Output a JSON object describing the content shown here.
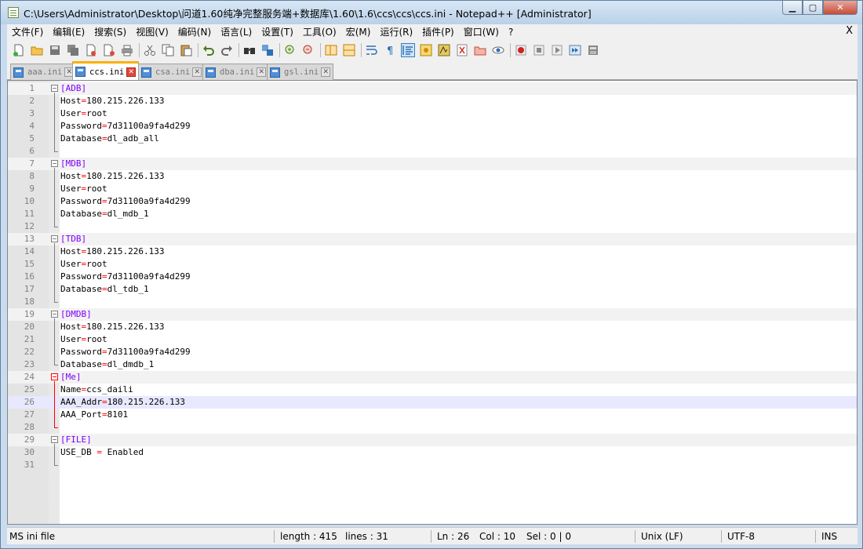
{
  "window": {
    "title": "C:\\Users\\Administrator\\Desktop\\问道1.60纯净完整服务端+数据库\\1.60\\1.6\\ccs\\ccs\\ccs.ini - Notepad++ [Administrator]",
    "minimize_label": "▁",
    "maximize_label": "▢",
    "close_label": "✕"
  },
  "menubar": {
    "items": [
      "文件(F)",
      "编辑(E)",
      "搜索(S)",
      "视图(V)",
      "编码(N)",
      "语言(L)",
      "设置(T)",
      "工具(O)",
      "宏(M)",
      "运行(R)",
      "插件(P)",
      "窗口(W)",
      "?"
    ],
    "close_label": "X"
  },
  "toolbar": {
    "icons": [
      "new-file",
      "open-file",
      "save",
      "save-all",
      "close",
      "close-all",
      "print",
      "cut",
      "copy",
      "paste",
      "undo",
      "redo",
      "find",
      "replace",
      "zoom-in",
      "zoom-out",
      "sync-vertical",
      "sync-horizontal",
      "word-wrap",
      "show-all-characters",
      "indent-guide",
      "user-defined-language",
      "doc-map",
      "function-list",
      "folder-workspace",
      "monitoring",
      "record-macro",
      "stop-record",
      "play-macro",
      "run-macro-multiple",
      "save-macro"
    ]
  },
  "tabs": [
    {
      "label": "aaa.ini",
      "active": false
    },
    {
      "label": "ccs.ini",
      "active": true
    },
    {
      "label": "csa.ini",
      "active": false
    },
    {
      "label": "dba.ini",
      "active": false
    },
    {
      "label": "gsl.ini",
      "active": false
    }
  ],
  "editor": {
    "current_line": 26,
    "lines": [
      {
        "n": "1",
        "key": "",
        "op": "",
        "val": "",
        "section": "[ADB]"
      },
      {
        "n": "2",
        "key": "Host",
        "op": "=",
        "val": "180.215.226.133",
        "section": ""
      },
      {
        "n": "3",
        "key": "User",
        "op": "=",
        "val": "root",
        "section": ""
      },
      {
        "n": "4",
        "key": "Password",
        "op": "=",
        "val": "7d31100a9fa4d299",
        "section": ""
      },
      {
        "n": "5",
        "key": "Database",
        "op": "=",
        "val": "dl_adb_all",
        "section": ""
      },
      {
        "n": "6",
        "key": "",
        "op": "",
        "val": "",
        "section": ""
      },
      {
        "n": "7",
        "key": "",
        "op": "",
        "val": "",
        "section": "[MDB]"
      },
      {
        "n": "8",
        "key": "Host",
        "op": "=",
        "val": "180.215.226.133",
        "section": ""
      },
      {
        "n": "9",
        "key": "User",
        "op": "=",
        "val": "root",
        "section": ""
      },
      {
        "n": "10",
        "key": "Password",
        "op": "=",
        "val": "7d31100a9fa4d299",
        "section": ""
      },
      {
        "n": "11",
        "key": "Database",
        "op": "=",
        "val": "dl_mdb_1",
        "section": ""
      },
      {
        "n": "12",
        "key": "",
        "op": "",
        "val": "",
        "section": ""
      },
      {
        "n": "13",
        "key": "",
        "op": "",
        "val": "",
        "section": "[TDB]"
      },
      {
        "n": "14",
        "key": "Host",
        "op": "=",
        "val": "180.215.226.133",
        "section": ""
      },
      {
        "n": "15",
        "key": "User",
        "op": "=",
        "val": "root",
        "section": ""
      },
      {
        "n": "16",
        "key": "Password",
        "op": "=",
        "val": "7d31100a9fa4d299",
        "section": ""
      },
      {
        "n": "17",
        "key": "Database",
        "op": "=",
        "val": "dl_tdb_1",
        "section": ""
      },
      {
        "n": "18",
        "key": "",
        "op": "",
        "val": "",
        "section": ""
      },
      {
        "n": "19",
        "key": "",
        "op": "",
        "val": "",
        "section": "[DMDB]"
      },
      {
        "n": "20",
        "key": "Host",
        "op": "=",
        "val": "180.215.226.133",
        "section": ""
      },
      {
        "n": "21",
        "key": "User",
        "op": "=",
        "val": "root",
        "section": ""
      },
      {
        "n": "22",
        "key": "Password",
        "op": "=",
        "val": "7d31100a9fa4d299",
        "section": ""
      },
      {
        "n": "23",
        "key": "Database",
        "op": "=",
        "val": "dl_dmdb_1",
        "section": ""
      },
      {
        "n": "24",
        "key": "",
        "op": "",
        "val": "",
        "section": "[Me]"
      },
      {
        "n": "25",
        "key": "Name",
        "op": "=",
        "val": "ccs_daili",
        "section": ""
      },
      {
        "n": "26",
        "key": "AAA_Addr",
        "op": "=",
        "val": "180.215.226.133",
        "section": ""
      },
      {
        "n": "27",
        "key": "AAA_Port",
        "op": "=",
        "val": "8101",
        "section": ""
      },
      {
        "n": "28",
        "key": "",
        "op": "",
        "val": "",
        "section": ""
      },
      {
        "n": "29",
        "key": "",
        "op": "",
        "val": "",
        "section": "[FILE]"
      },
      {
        "n": "30",
        "key": "USE_DB ",
        "op": "=",
        "val": " Enabled",
        "section": ""
      },
      {
        "n": "31",
        "key": "",
        "op": "",
        "val": "",
        "section": ""
      }
    ],
    "folds": [
      {
        "start": 1,
        "end": 6,
        "active": false
      },
      {
        "start": 7,
        "end": 12,
        "active": false
      },
      {
        "start": 13,
        "end": 18,
        "active": false
      },
      {
        "start": 19,
        "end": 23,
        "active": false
      },
      {
        "start": 24,
        "end": 28,
        "active": true
      },
      {
        "start": 29,
        "end": 31,
        "active": false
      }
    ]
  },
  "statusbar": {
    "language": "MS ini file",
    "length": "length : 415",
    "lines": "lines : 31",
    "ln": "Ln : 26",
    "col": "Col : 10",
    "sel": "Sel : 0 | 0",
    "eol": "Unix (LF)",
    "encoding": "UTF-8",
    "mode": "INS"
  },
  "colors": {
    "section": "#8000ff",
    "operator": "#ff0000",
    "active_tab_accent": "#fab000",
    "current_line": "#e8e8ff"
  }
}
